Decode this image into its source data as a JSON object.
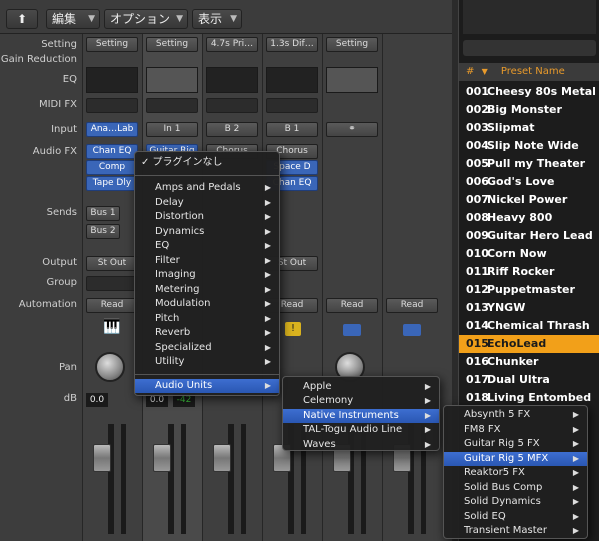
{
  "toolbar": {
    "up_label": "⬆",
    "edit_label": "編集",
    "options_label": "オプション",
    "view_label": "表示"
  },
  "rows": {
    "setting": "Setting",
    "gain_reduction": "Gain Reduction",
    "eq": "EQ",
    "midi_fx": "MIDI FX",
    "input": "Input",
    "audio_fx": "Audio FX",
    "sends": "Sends",
    "output": "Output",
    "group": "Group",
    "automation": "Automation",
    "pan": "Pan",
    "db": "dB"
  },
  "strips": [
    {
      "setting": "Setting",
      "input": "Ana…Lab",
      "fx": [
        "Chan EQ",
        "Comp",
        "Tape Dly"
      ],
      "sends": [
        "Bus 1",
        "Bus 2"
      ],
      "output": "St Out",
      "automation": "Read",
      "db": "0.0"
    },
    {
      "setting": "Setting",
      "input": "In 1",
      "fx": [
        "Guitar Rig"
      ],
      "output": "",
      "automation": "",
      "db": "0.0",
      "db2": "-42"
    },
    {
      "setting": "4.7s Pri…",
      "input": "B 2",
      "fx": [
        "Chorus"
      ],
      "output": "",
      "automation": "",
      "db": ""
    },
    {
      "setting": "1.3s Dif…",
      "input": "B 1",
      "fx": [
        "Chorus",
        "Space D",
        "Chan EQ"
      ],
      "output": "St Out",
      "automation": "Read",
      "db": ""
    },
    {
      "setting": "Setting",
      "input": "",
      "fx": [],
      "output": "",
      "automation": "Read",
      "db": ""
    },
    {
      "setting": "",
      "input": "",
      "fx": [],
      "output": "",
      "automation": "Read",
      "db": ""
    }
  ],
  "browser": {
    "col_num": "#",
    "col_name": "Preset Name",
    "presets": [
      {
        "num": "001",
        "name": "Cheesy 80s Metal Lead"
      },
      {
        "num": "002",
        "name": "Big Monster"
      },
      {
        "num": "003",
        "name": "Slipmat"
      },
      {
        "num": "004",
        "name": "Slip Note Wide"
      },
      {
        "num": "005",
        "name": "Pull my Theater"
      },
      {
        "num": "006",
        "name": "God's Love"
      },
      {
        "num": "007",
        "name": "Nickel Power"
      },
      {
        "num": "008",
        "name": "Heavy 800"
      },
      {
        "num": "009",
        "name": "Guitar Hero Lead"
      },
      {
        "num": "010",
        "name": "Corn Now"
      },
      {
        "num": "011",
        "name": "Riff Rocker"
      },
      {
        "num": "012",
        "name": "Puppetmaster"
      },
      {
        "num": "013",
        "name": "YNGW"
      },
      {
        "num": "014",
        "name": "Chemical Thrash"
      },
      {
        "num": "015",
        "name": "EchoLead"
      },
      {
        "num": "016",
        "name": "Chunker"
      },
      {
        "num": "017",
        "name": "Dual Ultra"
      },
      {
        "num": "018",
        "name": "Living Entombed"
      }
    ]
  },
  "menu1": {
    "no_plugin": "✓ プラグインなし",
    "items": [
      "Amps and Pedals",
      "Delay",
      "Distortion",
      "Dynamics",
      "EQ",
      "Filter",
      "Imaging",
      "Metering",
      "Modulation",
      "Pitch",
      "Reverb",
      "Specialized",
      "Utility"
    ],
    "audio_units": "Audio Units"
  },
  "menu2": {
    "items": [
      "Apple",
      "Celemony",
      "Native Instruments",
      "TAL-Togu Audio Line",
      "Waves"
    ]
  },
  "menu3": {
    "items": [
      "Absynth 5 FX",
      "FM8 FX",
      "Guitar Rig 5 FX",
      "Guitar Rig 5 MFX",
      "Reaktor5 FX",
      "Solid Bus Comp",
      "Solid Dynamics",
      "Solid EQ",
      "Transient Master"
    ]
  }
}
